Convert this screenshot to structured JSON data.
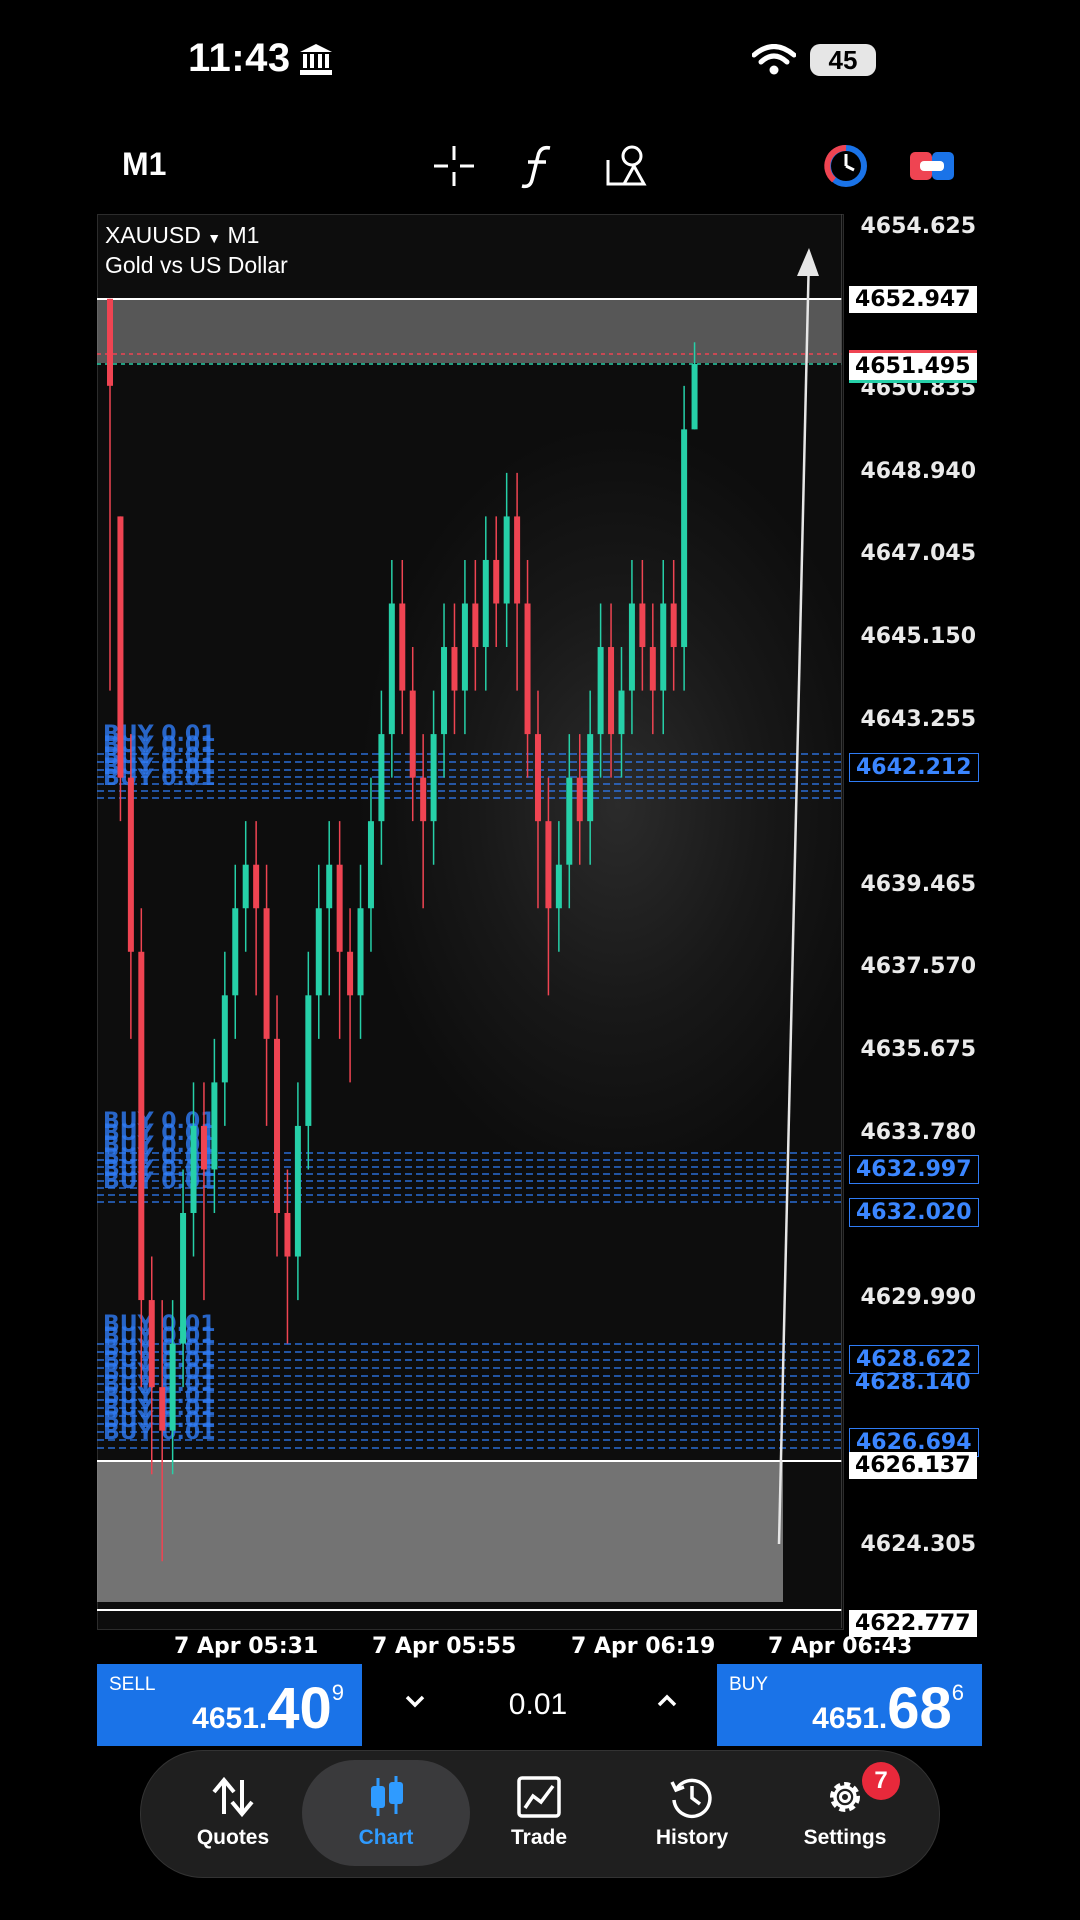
{
  "status_bar": {
    "time": "11:43",
    "battery": "45"
  },
  "toolbar": {
    "timeframe": "M1",
    "icons": [
      "crosshair-icon",
      "function-icon",
      "objects-icon",
      "timer-icon",
      "toggle-icon"
    ]
  },
  "chart": {
    "symbol": "XAUUSD",
    "timeframe": "M1",
    "description": "Gold vs US Dollar",
    "y_axis_labels": [
      "4654.625",
      "4650.835",
      "4648.940",
      "4647.045",
      "4645.150",
      "4643.255",
      "4639.465",
      "4637.570",
      "4635.675",
      "4633.780",
      "4629.990",
      "4624.305"
    ],
    "price_boxes": [
      {
        "value": "4652.947",
        "style": "white"
      },
      {
        "value": "4651.495",
        "style": "white-teal"
      },
      {
        "value": "4642.212",
        "style": "blue"
      },
      {
        "value": "4632.997",
        "style": "blue"
      },
      {
        "value": "4632.020",
        "style": "blue"
      },
      {
        "value": "4628.622",
        "style": "blue"
      },
      {
        "value": "4628.140",
        "style": "blue-plain"
      },
      {
        "value": "4626.694",
        "style": "blue"
      },
      {
        "value": "4626.137",
        "style": "white"
      },
      {
        "value": "4622.777",
        "style": "white"
      }
    ],
    "order_label": "BUY 0.01",
    "time_labels": [
      "7 Apr 05:31",
      "7 Apr 05:55",
      "7 Apr 06:19",
      "7 Apr 06:43"
    ],
    "colors": {
      "bull": "#26d0a8",
      "bear": "#ef4452",
      "order_line": "#2f7cf6",
      "accent": "#1a73e8"
    }
  },
  "trade": {
    "sell_label": "SELL",
    "sell_prefix": "4651.",
    "sell_big": "40",
    "sell_sup": "9",
    "buy_label": "BUY",
    "buy_prefix": "4651.",
    "buy_big": "68",
    "buy_sup": "6",
    "volume": "0.01"
  },
  "nav": {
    "items": [
      {
        "label": "Quotes"
      },
      {
        "label": "Chart"
      },
      {
        "label": "Trade"
      },
      {
        "label": "History"
      },
      {
        "label": "Settings"
      }
    ],
    "settings_badge": "7"
  }
}
